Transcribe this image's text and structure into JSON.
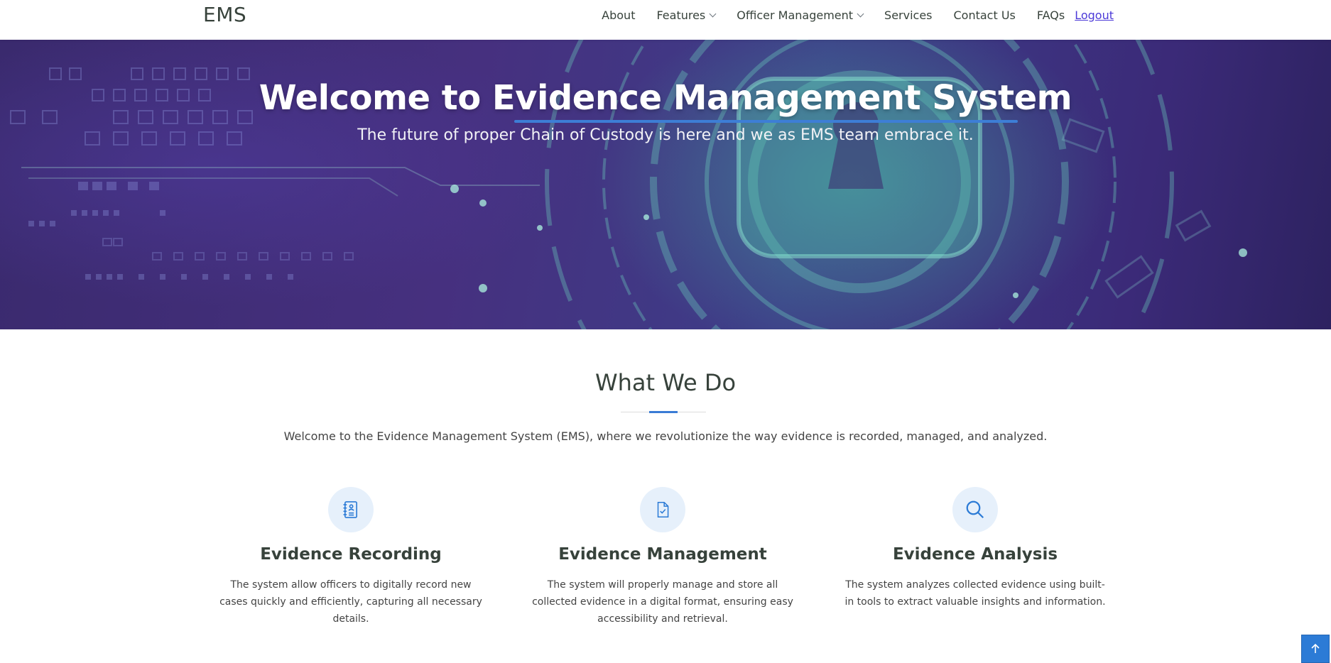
{
  "header": {
    "logo": "EMS",
    "nav": [
      {
        "label": "About"
      },
      {
        "label": "Features"
      },
      {
        "label": "Officer Management"
      },
      {
        "label": "Services"
      },
      {
        "label": "Contact Us"
      },
      {
        "label": "FAQs"
      }
    ],
    "logout": "Logout"
  },
  "hero": {
    "title": "Welcome to Evidence Management System",
    "subtitle": "The future of proper Chain of Custody is here and we as EMS team embrace it."
  },
  "section": {
    "title": "What We Do",
    "description": "Welcome to the Evidence Management System (EMS), where we revolutionize the way evidence is recorded, managed, and analyzed."
  },
  "features": [
    {
      "icon": "journal-icon",
      "title": "Evidence Recording",
      "text": "The system allow officers to digitally record new cases quickly and efficiently, capturing all necessary details."
    },
    {
      "icon": "file-check-icon",
      "title": "Evidence Management",
      "text": "The system will properly manage and store all collected evidence in a digital format, ensuring easy accessibility and retrieval."
    },
    {
      "icon": "search-icon",
      "title": "Evidence Analysis",
      "text": "The system analyzes collected evidence using built-in tools to extract valuable insights and information."
    }
  ],
  "colors": {
    "accent": "#3a7bd5",
    "hero_dark": "#3a2a6e",
    "text": "#37423b"
  }
}
